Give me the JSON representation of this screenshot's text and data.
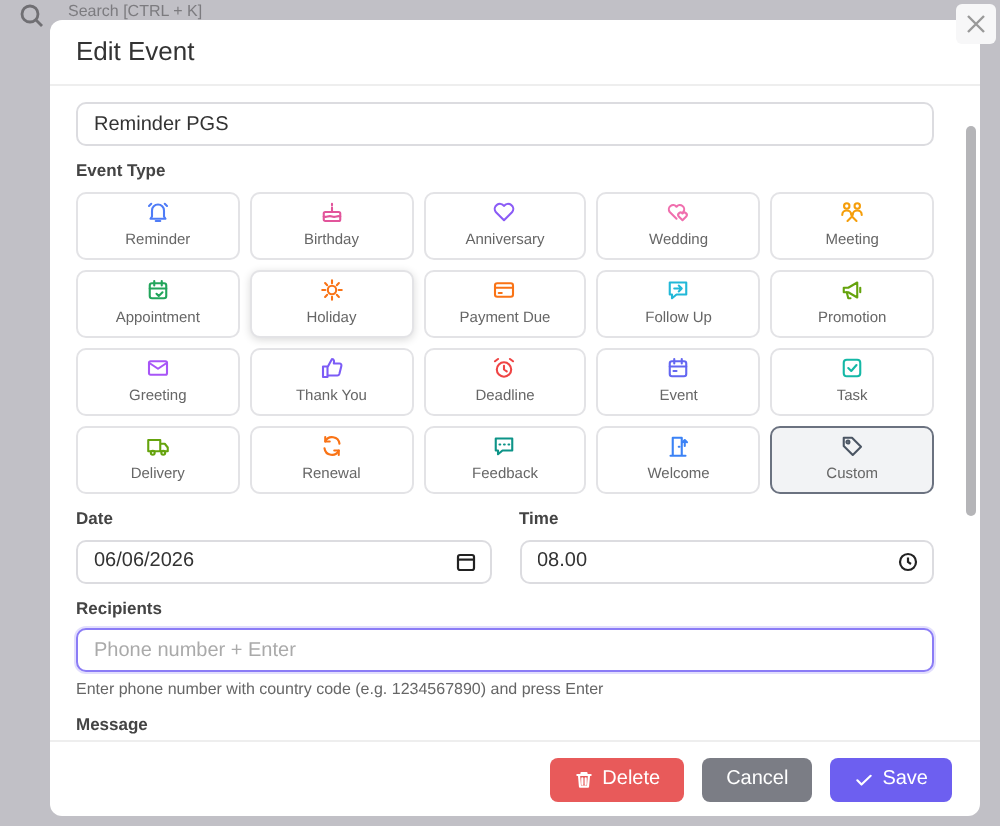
{
  "background": {
    "search_placeholder": "Search [CTRL + K]"
  },
  "modal": {
    "title": "Edit Event",
    "title_value": "Reminder PGS",
    "event_type_label": "Event Type",
    "event_types": [
      {
        "label": "Reminder",
        "color": "#4f7cf7",
        "selected": false,
        "hovered": false
      },
      {
        "label": "Birthday",
        "color": "#e2559b",
        "selected": false,
        "hovered": false
      },
      {
        "label": "Anniversary",
        "color": "#8b5cf6",
        "selected": false,
        "hovered": false
      },
      {
        "label": "Wedding",
        "color": "#f06fae",
        "selected": false,
        "hovered": false
      },
      {
        "label": "Meeting",
        "color": "#f59e0b",
        "selected": false,
        "hovered": false
      },
      {
        "label": "Appointment",
        "color": "#22a55b",
        "selected": false,
        "hovered": false
      },
      {
        "label": "Holiday",
        "color": "#f97316",
        "selected": false,
        "hovered": true
      },
      {
        "label": "Payment Due",
        "color": "#f97316",
        "selected": false,
        "hovered": false
      },
      {
        "label": "Follow Up",
        "color": "#22b8d8",
        "selected": false,
        "hovered": false
      },
      {
        "label": "Promotion",
        "color": "#65a30d",
        "selected": false,
        "hovered": false
      },
      {
        "label": "Greeting",
        "color": "#a855f7",
        "selected": false,
        "hovered": false
      },
      {
        "label": "Thank You",
        "color": "#7c5cf6",
        "selected": false,
        "hovered": false
      },
      {
        "label": "Deadline",
        "color": "#ef4444",
        "selected": false,
        "hovered": false
      },
      {
        "label": "Event",
        "color": "#6366f1",
        "selected": false,
        "hovered": false
      },
      {
        "label": "Task",
        "color": "#14b8a6",
        "selected": false,
        "hovered": false
      },
      {
        "label": "Delivery",
        "color": "#65a30d",
        "selected": false,
        "hovered": false
      },
      {
        "label": "Renewal",
        "color": "#f97316",
        "selected": false,
        "hovered": false
      },
      {
        "label": "Feedback",
        "color": "#0d9488",
        "selected": false,
        "hovered": false
      },
      {
        "label": "Welcome",
        "color": "#3b82f6",
        "selected": false,
        "hovered": false
      },
      {
        "label": "Custom",
        "color": "#4b5563",
        "selected": true,
        "hovered": false
      }
    ],
    "date_label": "Date",
    "date_value": "06/06/2026",
    "time_label": "Time",
    "time_value": "08.00",
    "recipients_label": "Recipients",
    "recipients_placeholder": "Phone number + Enter",
    "recipients_help": "Enter phone number with country code (e.g. 1234567890) and press Enter",
    "message_label": "Message",
    "buttons": [
      {
        "kind": "delete",
        "label": "Delete"
      },
      {
        "kind": "cancel",
        "label": "Cancel"
      },
      {
        "kind": "save",
        "label": "Save"
      }
    ]
  }
}
